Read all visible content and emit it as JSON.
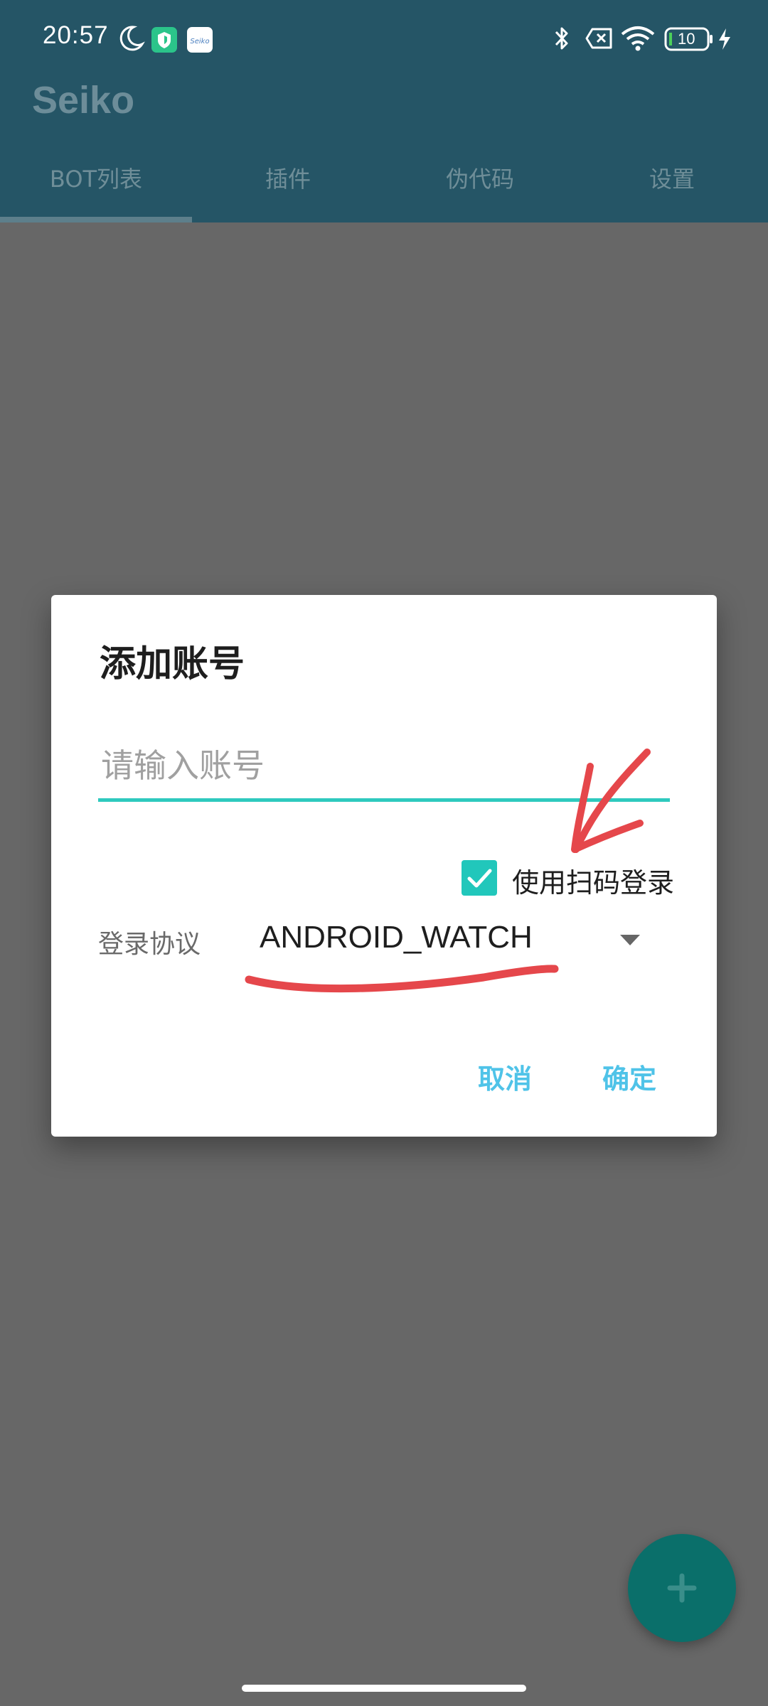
{
  "status_bar": {
    "time": "20:57",
    "battery_level": "10",
    "icons": [
      "moon-icon",
      "shield-app-icon",
      "seiko-app-icon",
      "bluetooth-icon",
      "no-sim-icon",
      "wifi-icon",
      "battery-icon",
      "charging-icon"
    ]
  },
  "app": {
    "title": "Seiko",
    "tabs": [
      {
        "label": "BOT列表",
        "selected": true
      },
      {
        "label": "插件",
        "selected": false
      },
      {
        "label": "伪代码",
        "selected": false
      },
      {
        "label": "设置",
        "selected": false
      }
    ]
  },
  "dialog": {
    "title": "添加账号",
    "account_input": {
      "value": "",
      "placeholder": "请输入账号"
    },
    "qr_login": {
      "label": "使用扫码登录",
      "checked": true
    },
    "protocol": {
      "label": "登录协议",
      "value": "ANDROID_WATCH"
    },
    "buttons": {
      "cancel": "取消",
      "confirm": "确定"
    }
  },
  "fab": {
    "icon": "plus-icon"
  },
  "colors": {
    "appbar": "#255566",
    "scrim_background": "#676767",
    "accent_teal": "#21c7bb",
    "button_text": "#4fc3e8",
    "fab": "#0a6f6a",
    "annotation_red": "#e5474b"
  }
}
